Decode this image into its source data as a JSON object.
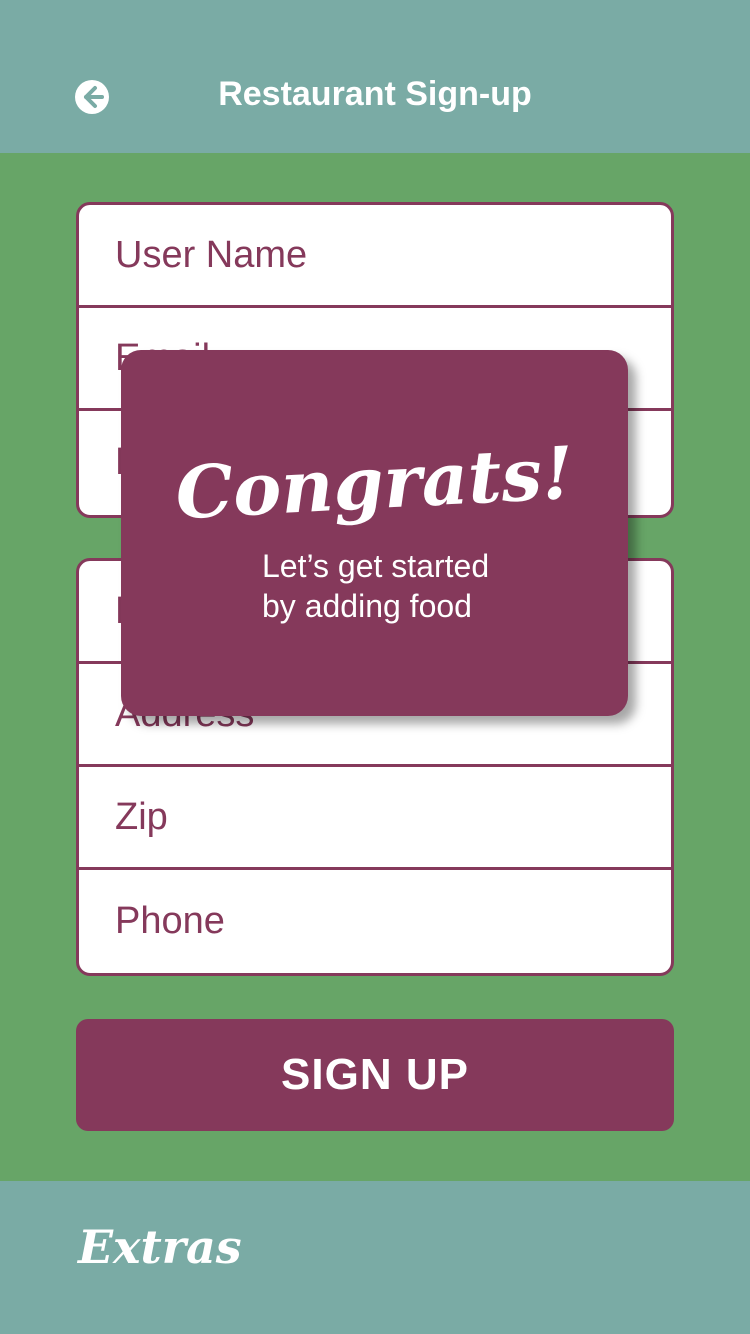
{
  "header": {
    "title": "Restaurant Sign-up",
    "back_icon": "arrow-left-circle-icon"
  },
  "account_fields": [
    {
      "placeholder": "User Name"
    },
    {
      "placeholder": "Email"
    },
    {
      "placeholder": "Password"
    }
  ],
  "restaurant_fields": [
    {
      "placeholder": "Restaurant Name"
    },
    {
      "placeholder": "Address"
    },
    {
      "placeholder": "Zip"
    },
    {
      "placeholder": "Phone"
    }
  ],
  "signup_button": {
    "label": "SIGN UP"
  },
  "footer": {
    "brand": "Extras"
  },
  "modal": {
    "title": "Congrats!",
    "line1": "Let’s get started",
    "line2": "by adding food"
  },
  "colors": {
    "header_bg": "#7aaba5",
    "page_bg": "#67a567",
    "accent": "#85395b",
    "field_bg": "#ffffff"
  }
}
